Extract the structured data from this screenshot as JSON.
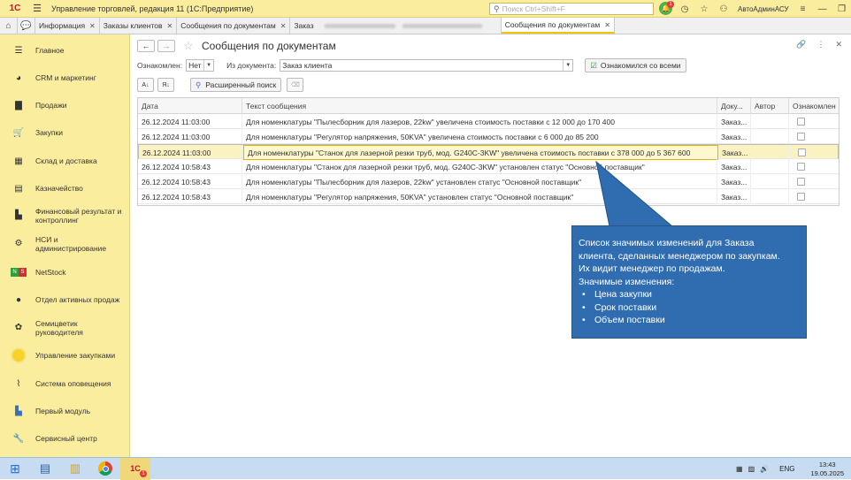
{
  "titlebar": {
    "logo_text": "1С",
    "title": "Управление торговлей, редакция 11  (1С:Предприятие)",
    "search_placeholder": "Поиск Ctrl+Shift+F",
    "notifications_count": "1",
    "user": "АвтоАдминАСУ"
  },
  "tabs": [
    {
      "label": "Информация"
    },
    {
      "label": "Заказы клиентов"
    },
    {
      "label": "Сообщения по документам"
    },
    {
      "label": "Заказ"
    },
    {
      "label": "Сообщения по документам"
    }
  ],
  "sidebar": {
    "items": [
      {
        "label": "Главное",
        "icon": "menu-icon"
      },
      {
        "label": "CRM и маркетинг",
        "icon": "pie-chart-icon"
      },
      {
        "label": "Продажи",
        "icon": "bag-icon"
      },
      {
        "label": "Закупки",
        "icon": "cart-icon"
      },
      {
        "label": "Склад и доставка",
        "icon": "grid-icon"
      },
      {
        "label": "Казначейство",
        "icon": "coins-icon"
      },
      {
        "label": "Финансовый результат и контроллинг",
        "icon": "bar-chart-icon"
      },
      {
        "label": "НСИ и администрирование",
        "icon": "gear-icon"
      },
      {
        "label": "NetStock",
        "icon": "netstock-icon"
      },
      {
        "label": "Отдел активных продаж",
        "icon": "person-icon"
      },
      {
        "label": "Семицветик руководителя",
        "icon": "flower-icon"
      },
      {
        "label": "Управление закупками",
        "icon": "circle-icon"
      },
      {
        "label": "Система оповещения",
        "icon": "bell-icon"
      },
      {
        "label": "Первый модуль",
        "icon": "module-icon"
      },
      {
        "label": "Сервисный центр",
        "icon": "wrench-icon"
      }
    ]
  },
  "form": {
    "title": "Сообщения по документам",
    "acquainted_label": "Ознакомлен:",
    "acquainted_value": "Нет",
    "document_label": "Из документа:",
    "document_value": "Заказ клиента",
    "ack_all_button": "Ознакомился со всеми",
    "advanced_search_button": "Расширенный поиск"
  },
  "table": {
    "columns": [
      "Дата",
      "Текст сообщения",
      "Доку...",
      "Автор",
      "Ознакомлен"
    ],
    "rows": [
      {
        "date": "26.12.2024 11:03:00",
        "text": "Для номенклатуры \"Пылесборник для лазеров, 22kw\" увеличена стоимость поставки с 12 000 до 170 400",
        "doc": "Заказ...",
        "author": "",
        "checked": false
      },
      {
        "date": "26.12.2024 11:03:00",
        "text": "Для номенклатуры \"Регулятор напряжения, 50KVA\" увеличена стоимость поставки с 6 000 до 85 200",
        "doc": "Заказ...",
        "author": "",
        "checked": false
      },
      {
        "date": "26.12.2024 11:03:00",
        "text": "Для номенклатуры \"Станок для лазерной резки труб, мод. G240C-3KW\" увеличена стоимость поставки с 378 000 до 5 367 600",
        "doc": "Заказ...",
        "author": "",
        "checked": false
      },
      {
        "date": "26.12.2024 10:58:43",
        "text": "Для номенклатуры \"Станок для лазерной резки труб, мод. G240C-3KW\" установлен статус \"Основной поставщик\"",
        "doc": "Заказ...",
        "author": "",
        "checked": false
      },
      {
        "date": "26.12.2024 10:58:43",
        "text": "Для номенклатуры \"Пылесборник для лазеров, 22kw\" установлен статус \"Основной поставщик\"",
        "doc": "Заказ...",
        "author": "",
        "checked": false
      },
      {
        "date": "26.12.2024 10:58:43",
        "text": "Для номенклатуры \"Регулятор напряжения, 50KVA\" установлен статус \"Основной поставщик\"",
        "doc": "Заказ...",
        "author": "",
        "checked": false
      }
    ]
  },
  "callout": {
    "lines": [
      "Список значимых изменений для Заказа",
      "клиента, сделанных менеджером по закупкам.",
      "Их видит менеджер по продажам.",
      "Значимые изменения:"
    ],
    "bullets": [
      "Цена закупки",
      "Срок поставки",
      "Объем поставки"
    ],
    "color": "#2f6db0"
  },
  "taskbar": {
    "lang": "ENG",
    "time": "13:43",
    "date": "19.05.2025",
    "app_badge": "1"
  }
}
